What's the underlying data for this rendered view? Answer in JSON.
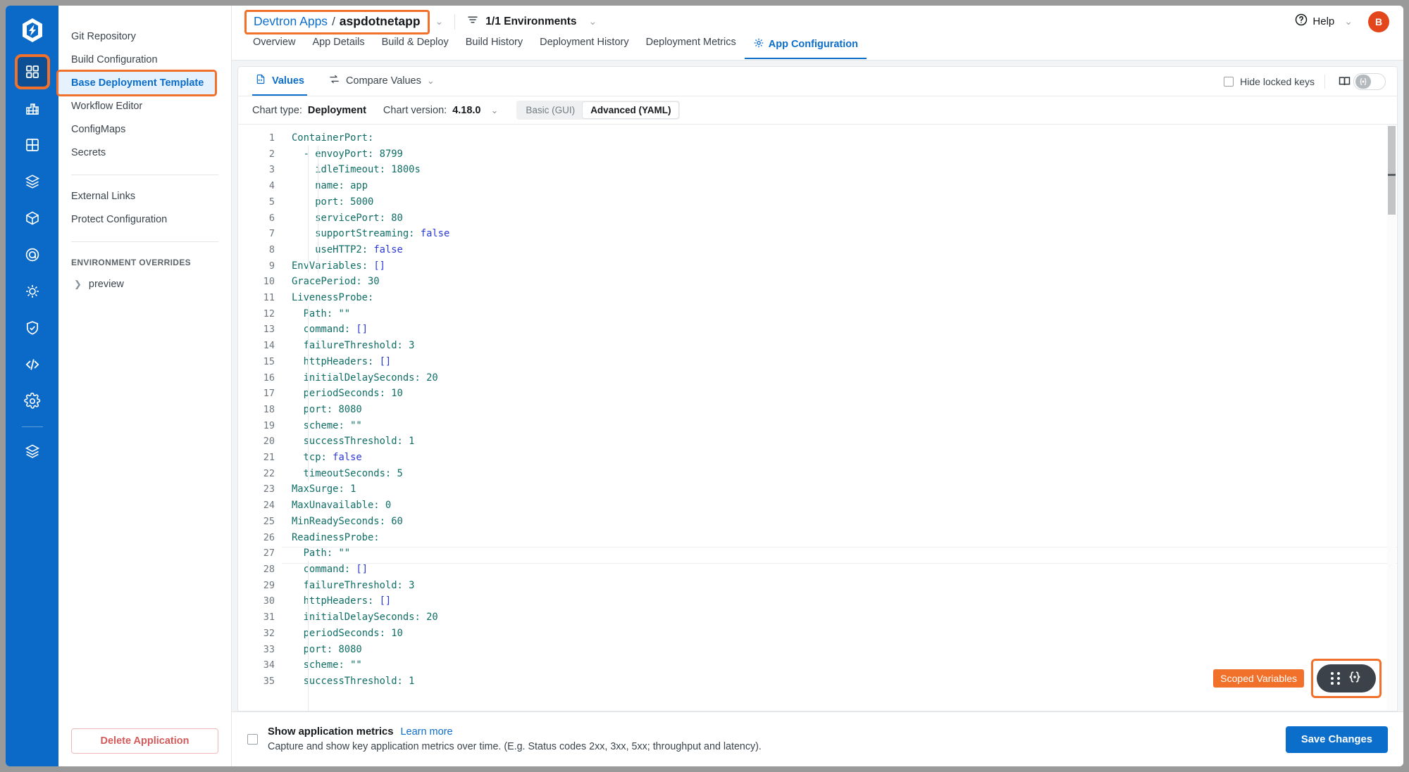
{
  "rail": {
    "logo_icon": "devtron-logo-icon",
    "items": [
      {
        "icon": "applications-grid-icon",
        "name": "applications",
        "active": true
      },
      {
        "icon": "jobs-chart-icon",
        "name": "jobs",
        "active": false
      },
      {
        "icon": "clusters-grid-icon",
        "name": "clusters",
        "active": false
      },
      {
        "icon": "chart-store-box-icon",
        "name": "chart-store",
        "active": false
      },
      {
        "icon": "package-cube-icon",
        "name": "packages",
        "active": false
      },
      {
        "icon": "target-icon",
        "name": "deployment-groups",
        "active": false
      },
      {
        "icon": "bug-icon",
        "name": "resource-browser",
        "active": false
      },
      {
        "icon": "shield-icon",
        "name": "security",
        "active": false
      },
      {
        "icon": "code-icon",
        "name": "code",
        "active": false
      },
      {
        "icon": "gear-icon",
        "name": "global-configurations",
        "active": false
      }
    ],
    "bottom_items": [
      {
        "icon": "stack-layers-icon",
        "name": "stack-manager"
      }
    ]
  },
  "header": {
    "breadcrumb_parent": "Devtron Apps",
    "breadcrumb_separator": "/",
    "breadcrumb_current": "aspdotnetapp",
    "breadcrumb_chevron_icon": "chevron-down-icon",
    "env_filter_icon": "filter-icon",
    "env_label": "1/1 Environments",
    "env_chevron_icon": "chevron-down-icon",
    "help_icon": "question-circle-icon",
    "help_label": "Help",
    "help_chevron_icon": "chevron-down-icon",
    "avatar_initial": "B"
  },
  "tabs": [
    {
      "label": "Overview",
      "active": false
    },
    {
      "label": "App Details",
      "active": false
    },
    {
      "label": "Build & Deploy",
      "active": false
    },
    {
      "label": "Build History",
      "active": false
    },
    {
      "label": "Deployment History",
      "active": false
    },
    {
      "label": "Deployment Metrics",
      "active": false
    },
    {
      "label": "App Configuration",
      "active": true,
      "icon": "gear-icon"
    }
  ],
  "sidebar": {
    "items": [
      {
        "label": "Git Repository",
        "selected": false
      },
      {
        "label": "Build Configuration",
        "selected": false
      },
      {
        "label": "Base Deployment Template",
        "selected": true
      },
      {
        "label": "Workflow Editor",
        "selected": false
      },
      {
        "label": "ConfigMaps",
        "selected": false
      },
      {
        "label": "Secrets",
        "selected": false
      }
    ],
    "items2": [
      {
        "label": "External Links",
        "selected": false
      },
      {
        "label": "Protect Configuration",
        "selected": false
      }
    ],
    "section_title": "ENVIRONMENT OVERRIDES",
    "environments": [
      {
        "label": "preview",
        "chevron_icon": "chevron-right-icon"
      }
    ],
    "delete_button": "Delete Application"
  },
  "values_bar": {
    "values_tab": "Values",
    "values_icon": "file-code-icon",
    "compare_tab": "Compare Values",
    "compare_icon": "compare-arrows-icon",
    "compare_chevron_icon": "chevron-down-icon",
    "hide_locked_keys": "Hide locked keys",
    "hide_locked_checked": false,
    "readme_icon": "book-icon",
    "scoped_toggle_icon": "variable-braces-icon",
    "scoped_toggle_on": false
  },
  "chart_toolbar": {
    "chart_type_label": "Chart type:",
    "chart_type_value": "Deployment",
    "chart_version_label": "Chart version:",
    "chart_version_value": "4.18.0",
    "chart_version_chevron_icon": "chevron-down-icon",
    "mode_basic": "Basic (GUI)",
    "mode_advanced": "Advanced (YAML)",
    "mode_active": "Advanced (YAML)"
  },
  "editor": {
    "lines": [
      {
        "n": 1,
        "indent": 0,
        "text": "ContainerPort:",
        "kind": "mapkey"
      },
      {
        "n": 2,
        "indent": 1,
        "text": "- envoyPort: 8799",
        "kind": "dashnum"
      },
      {
        "n": 3,
        "indent": 2,
        "text": "idleTimeout: 1800s",
        "kind": "str"
      },
      {
        "n": 4,
        "indent": 2,
        "text": "name: app",
        "kind": "str"
      },
      {
        "n": 5,
        "indent": 2,
        "text": "port: 5000",
        "kind": "num"
      },
      {
        "n": 6,
        "indent": 2,
        "text": "servicePort: 80",
        "kind": "num"
      },
      {
        "n": 7,
        "indent": 2,
        "text": "supportStreaming: false",
        "kind": "bool"
      },
      {
        "n": 8,
        "indent": 2,
        "text": "useHTTP2: false",
        "kind": "bool"
      },
      {
        "n": 9,
        "indent": 0,
        "text": "EnvVariables: []",
        "kind": "arr"
      },
      {
        "n": 10,
        "indent": 0,
        "text": "GracePeriod: 30",
        "kind": "num"
      },
      {
        "n": 11,
        "indent": 0,
        "text": "LivenessProbe:",
        "kind": "mapkey"
      },
      {
        "n": 12,
        "indent": 1,
        "text": "Path: \"\"",
        "kind": "emptystr"
      },
      {
        "n": 13,
        "indent": 1,
        "text": "command: []",
        "kind": "arr"
      },
      {
        "n": 14,
        "indent": 1,
        "text": "failureThreshold: 3",
        "kind": "num"
      },
      {
        "n": 15,
        "indent": 1,
        "text": "httpHeaders: []",
        "kind": "arr"
      },
      {
        "n": 16,
        "indent": 1,
        "text": "initialDelaySeconds: 20",
        "kind": "num"
      },
      {
        "n": 17,
        "indent": 1,
        "text": "periodSeconds: 10",
        "kind": "num"
      },
      {
        "n": 18,
        "indent": 1,
        "text": "port: 8080",
        "kind": "num"
      },
      {
        "n": 19,
        "indent": 1,
        "text": "scheme: \"\"",
        "kind": "emptystr"
      },
      {
        "n": 20,
        "indent": 1,
        "text": "successThreshold: 1",
        "kind": "num"
      },
      {
        "n": 21,
        "indent": 1,
        "text": "tcp: false",
        "kind": "bool"
      },
      {
        "n": 22,
        "indent": 1,
        "text": "timeoutSeconds: 5",
        "kind": "num"
      },
      {
        "n": 23,
        "indent": 0,
        "text": "MaxSurge: 1",
        "kind": "num"
      },
      {
        "n": 24,
        "indent": 0,
        "text": "MaxUnavailable: 0",
        "kind": "num"
      },
      {
        "n": 25,
        "indent": 0,
        "text": "MinReadySeconds: 60",
        "kind": "num"
      },
      {
        "n": 26,
        "indent": 0,
        "text": "ReadinessProbe:",
        "kind": "mapkey"
      },
      {
        "n": 27,
        "indent": 1,
        "text": "Path: \"\"",
        "kind": "emptystr"
      },
      {
        "n": 28,
        "indent": 1,
        "text": "command: []",
        "kind": "arr"
      },
      {
        "n": 29,
        "indent": 1,
        "text": "failureThreshold: 3",
        "kind": "num"
      },
      {
        "n": 30,
        "indent": 1,
        "text": "httpHeaders: []",
        "kind": "arr"
      },
      {
        "n": 31,
        "indent": 1,
        "text": "initialDelaySeconds: 20",
        "kind": "num"
      },
      {
        "n": 32,
        "indent": 1,
        "text": "periodSeconds: 10",
        "kind": "num"
      },
      {
        "n": 33,
        "indent": 1,
        "text": "port: 8080",
        "kind": "num"
      },
      {
        "n": 34,
        "indent": 1,
        "text": "scheme: \"\"",
        "kind": "emptystr"
      },
      {
        "n": 35,
        "indent": 1,
        "text": "successThreshold: 1",
        "kind": "num"
      }
    ],
    "scoped_variables_tooltip": "Scoped Variables",
    "scoped_drag_icon": "drag-dots-icon",
    "scoped_braces_icon": "variable-braces-icon"
  },
  "footer": {
    "metrics_checked": false,
    "metrics_title": "Show application metrics",
    "metrics_link": "Learn more",
    "metrics_sub": "Capture and show key application metrics over time. (E.g. Status codes 2xx, 3xx, 5xx; throughput and latency).",
    "save_button": "Save Changes"
  },
  "colors": {
    "brand_blue": "#0b6ecb",
    "rail_blue": "#0b69c7",
    "highlight_orange": "#f2712a",
    "avatar_red": "#e3461a",
    "danger_red": "#d45a5a",
    "yaml_key": "#0f6e66",
    "yaml_bool": "#2b3ad6"
  }
}
